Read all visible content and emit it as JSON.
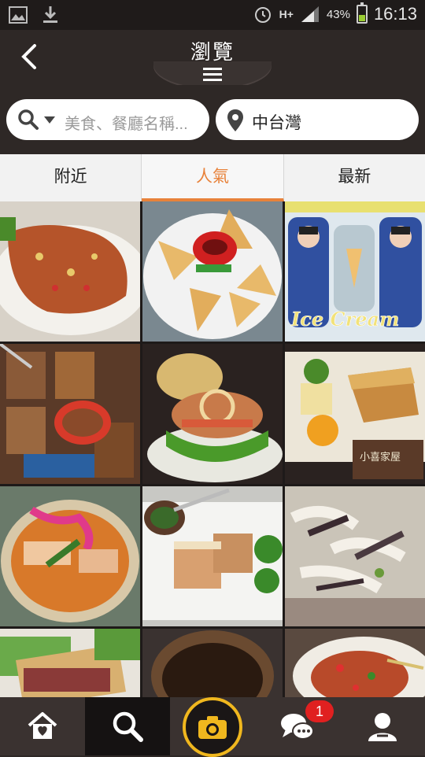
{
  "status_bar": {
    "network": "H+",
    "battery_percent": "43%",
    "time": "16:13",
    "icons": [
      "image-icon",
      "download-icon",
      "alarm-icon",
      "signal-icon",
      "battery-icon"
    ]
  },
  "header": {
    "title": "瀏覽",
    "back_icon": "back-icon",
    "menu_icon": "menu-icon"
  },
  "search": {
    "placeholder": "美食、餐廳名稱...",
    "location": "中台灣"
  },
  "tabs": [
    {
      "label": "附近",
      "active": false
    },
    {
      "label": "人氣",
      "active": true
    },
    {
      "label": "最新",
      "active": false
    }
  ],
  "photos": [
    {
      "caption": ""
    },
    {
      "caption": ""
    },
    {
      "caption": "Ice Cream"
    },
    {
      "caption": ""
    },
    {
      "caption": ""
    },
    {
      "caption": "小喜家屋"
    },
    {
      "caption": ""
    },
    {
      "caption": ""
    },
    {
      "caption": ""
    },
    {
      "caption": ""
    },
    {
      "caption": ""
    },
    {
      "caption": ""
    }
  ],
  "bottom_nav": {
    "items": [
      "home-icon",
      "search-icon",
      "camera-icon",
      "chat-icon",
      "profile-icon"
    ],
    "chat_badge": "1",
    "active": "search-icon"
  },
  "colors": {
    "accent": "#e8823a",
    "camera_ring": "#f0b71e",
    "badge": "#e02020",
    "bar_bg": "#2e2826"
  }
}
